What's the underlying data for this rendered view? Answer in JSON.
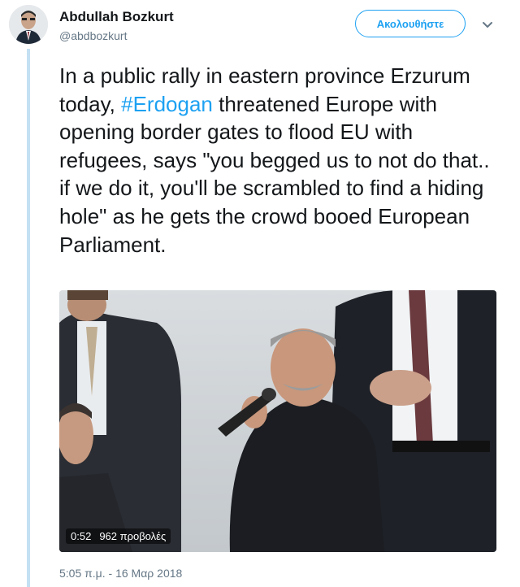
{
  "author": {
    "name": "Abdullah Bozkurt",
    "handle": "@abdbozkurt"
  },
  "follow_button": {
    "label": "Ακολουθήστε"
  },
  "menu": {
    "icon": "chevron-down-icon"
  },
  "tweet": {
    "text_before": "In a public rally in eastern province Erzurum today, ",
    "hashtag": "#Erdogan",
    "text_after": " threatened Europe with opening border gates to flood EU with refugees, says \"you begged us to not do that.. if we do it, you'll be scrambled to find a hiding hole\" as he gets the crowd booed European Parliament."
  },
  "media": {
    "type": "video",
    "duration": "0:52",
    "views": "962 προβολές"
  },
  "timestamp": "5:05 π.μ. - 16 Μαρ 2018",
  "colors": {
    "accent": "#1da1f2",
    "secondary_text": "#657786",
    "thread_line": "#c4e0f2"
  }
}
